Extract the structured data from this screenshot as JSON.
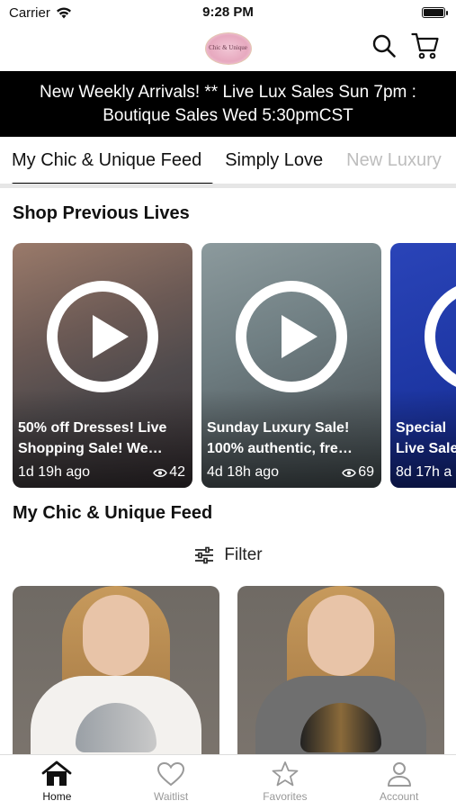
{
  "status_bar": {
    "carrier": "Carrier",
    "time": "9:28 PM"
  },
  "header": {
    "logo_text": "Chic & Unique"
  },
  "banner": {
    "line1": "New Weekly Arrivals! ** Live Lux Sales Sun 7pm :",
    "line2": "Boutique Sales Wed 5:30pmCST"
  },
  "tabs": [
    {
      "label": "My Chic & Unique Feed"
    },
    {
      "label": "Simply Love"
    },
    {
      "label": "New Luxury"
    }
  ],
  "shop_previous": {
    "title": "Shop Previous Lives",
    "items": [
      {
        "title": "50% off Dresses! Live",
        "subtitle": "Shopping Sale! We…",
        "age": "1d 19h ago",
        "views": "42"
      },
      {
        "title": "Sunday Luxury Sale!",
        "subtitle": "100% authentic, fre…",
        "age": "4d 18h ago",
        "views": "69"
      },
      {
        "title": "Special",
        "subtitle": "Live Sale",
        "age": "8d 17h a",
        "views": ""
      }
    ]
  },
  "feed": {
    "title": "My Chic & Unique Feed",
    "filter_label": "Filter"
  },
  "tabbar": [
    {
      "label": "Home",
      "icon": "home-icon"
    },
    {
      "label": "Waitlist",
      "icon": "heart-icon"
    },
    {
      "label": "Favorites",
      "icon": "star-icon"
    },
    {
      "label": "Account",
      "icon": "person-icon"
    }
  ]
}
